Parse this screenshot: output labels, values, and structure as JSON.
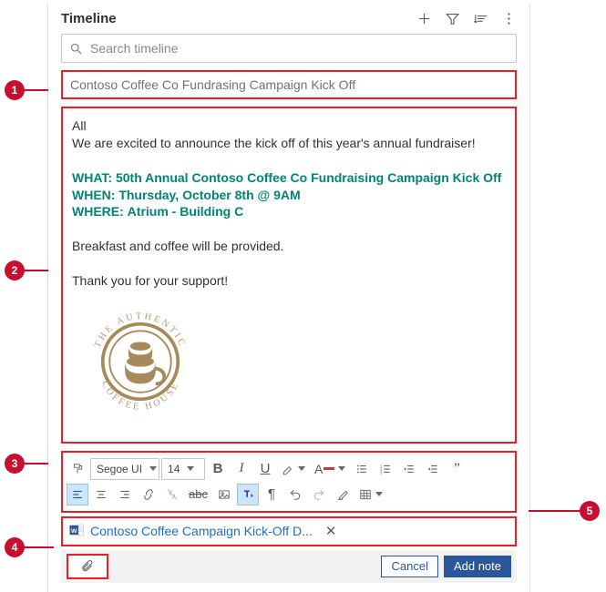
{
  "header": {
    "title": "Timeline"
  },
  "search": {
    "placeholder": "Search timeline"
  },
  "note": {
    "title": "Contoso Coffee Co Fundrasing Campaign Kick Off",
    "greeting": "All",
    "intro": "We are excited to announce the kick off of this year's annual fundraiser!",
    "what_label": "WHAT:",
    "what_value": "50th Annual Contoso Coffee Co Fundraising Campaign Kick Off",
    "when_label": "WHEN:",
    "when_value": "Thursday, October 8th @ 9AM",
    "where_label": "WHERE:",
    "where_value": "Atrium - Building C",
    "line2": "Breakfast and coffee will be provided.",
    "line3": "Thank you for your support!",
    "logo_top": "THE AUTHENTIC",
    "logo_bottom": "COFFEE HOUSE"
  },
  "toolbar": {
    "font_name": "Segoe UI",
    "font_size": "14"
  },
  "attachment": {
    "name": "Contoso Coffee Campaign Kick-Off D..."
  },
  "footer": {
    "cancel": "Cancel",
    "add": "Add note"
  },
  "callouts": {
    "c1": "1",
    "c2": "2",
    "c3": "3",
    "c4": "4",
    "c5": "5"
  }
}
